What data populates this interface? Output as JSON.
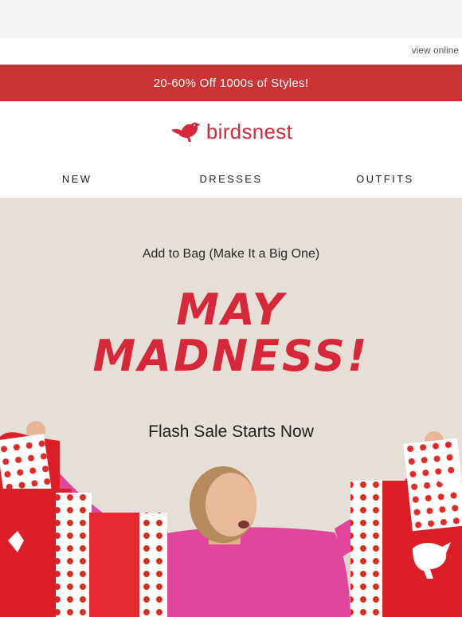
{
  "header": {
    "view_online": "view online"
  },
  "promo": {
    "text": "20-60% Off 1000s of Styles!"
  },
  "brand": {
    "name": "birdsnest",
    "color": "#d6283a",
    "icon": "bird-logo-icon"
  },
  "nav": {
    "items": [
      "NEW",
      "DRESSES",
      "OUTFITS"
    ]
  },
  "hero": {
    "eyebrow": "Add to Bag (Make It a Big One)",
    "title_line1": "MAY",
    "title_line2": "MADNESS!",
    "subtitle": "Flash Sale Starts Now",
    "image": "woman-with-shopping-bags-photo"
  },
  "colors": {
    "accent": "#cc3333",
    "brand_red": "#d6283a",
    "hero_bg": "#e6dfd7",
    "sweater_pink": "#e0479a"
  }
}
